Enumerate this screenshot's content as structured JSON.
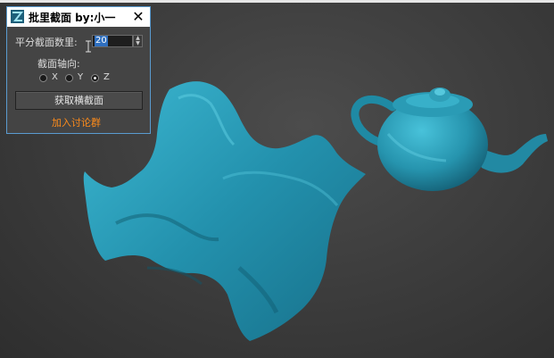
{
  "dialog": {
    "title": "批里截面 by:小一",
    "close_symbol": "✕",
    "count_label": "平分截面数里:",
    "count_value": "20",
    "axis_label": "截面轴向:",
    "axis_options": [
      {
        "label": "X",
        "checked": false
      },
      {
        "label": "Y",
        "checked": false
      },
      {
        "label": "Z",
        "checked": true
      }
    ],
    "action_button": "获取横截面",
    "group_link": "加入讨论群",
    "spinner_up": "▲",
    "spinner_down": "▼"
  },
  "colors": {
    "viewport_bg": "#3e3e3e",
    "mesh": "#2a9ab5",
    "link": "#ff8c1a",
    "dialog_border": "#5a9bd0"
  },
  "icons": [
    "app-icon",
    "close-icon",
    "spinner-up-icon",
    "spinner-down-icon",
    "text-cursor-icon"
  ]
}
